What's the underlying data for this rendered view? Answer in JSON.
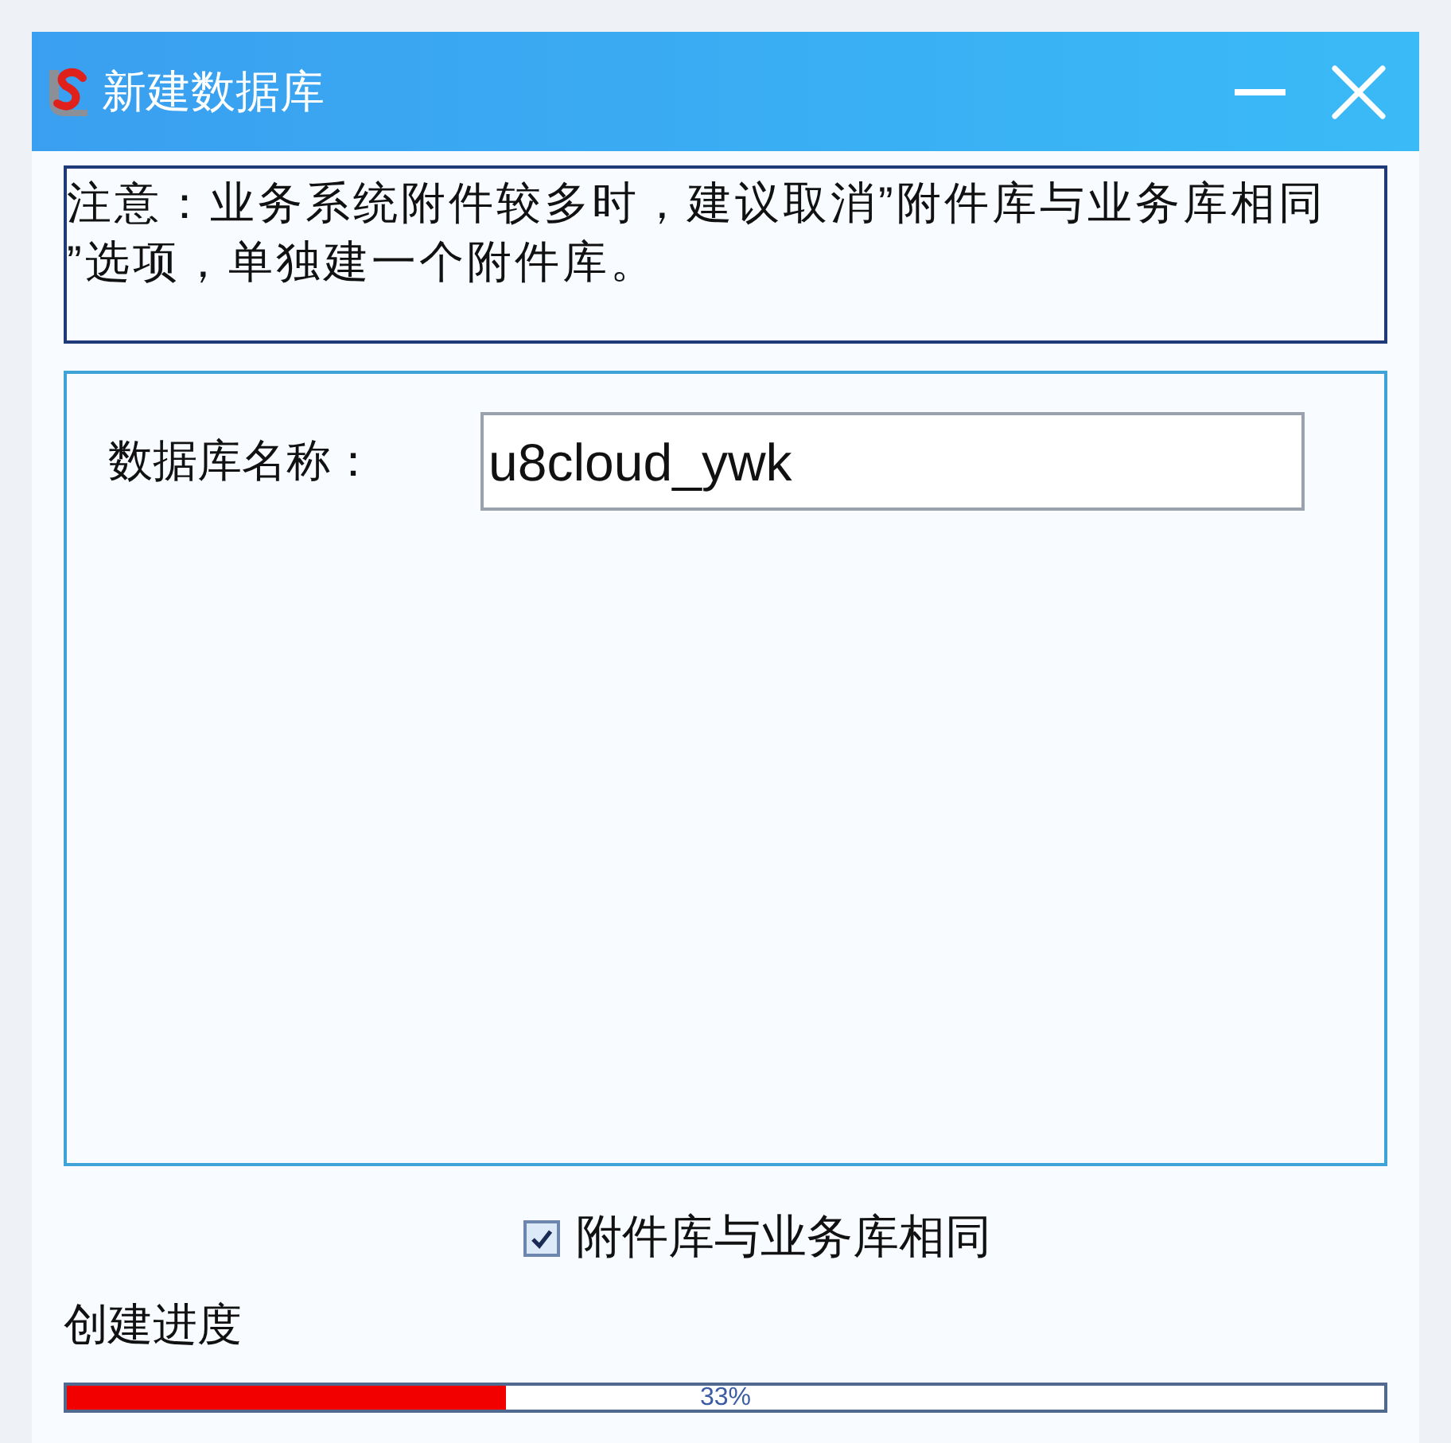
{
  "window": {
    "title": "新建数据库"
  },
  "notice": {
    "text": "注意：业务系统附件较多时，建议取消”附件库与业务库相同”选项，单独建一个附件库。"
  },
  "form": {
    "fields": [
      {
        "label": "数据库名称：",
        "value": "u8cloud_ywk"
      }
    ]
  },
  "options": [
    {
      "label": "附件库与业务库相同",
      "checked": true
    }
  ],
  "progress": {
    "label": "创建进度",
    "level": 0.333,
    "reading": "33%"
  }
}
